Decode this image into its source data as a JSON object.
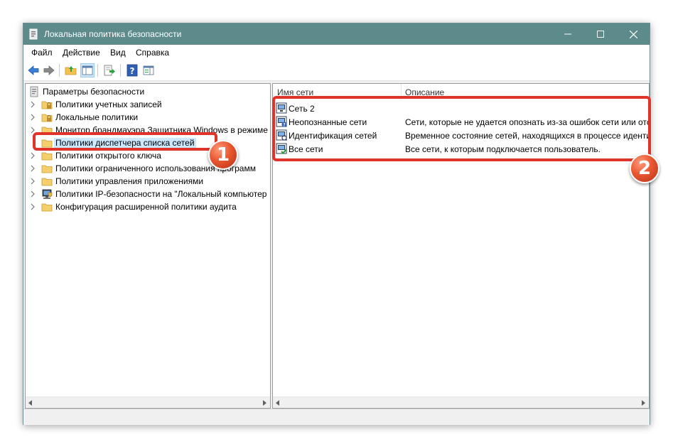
{
  "window": {
    "title": "Локальная политика безопасности",
    "controls": {
      "minimize": "—",
      "maximize": "☐",
      "close": "✕"
    }
  },
  "menu": [
    {
      "label": "Файл"
    },
    {
      "label": "Действие"
    },
    {
      "label": "Вид"
    },
    {
      "label": "Справка"
    }
  ],
  "toolbar": {
    "icons": [
      "back-arrow-icon",
      "forward-arrow-icon",
      "up-folder-icon",
      "show-hide-tree-icon",
      "export-list-icon",
      "help-icon",
      "show-hide-action-pane-icon"
    ]
  },
  "tree": {
    "root": "Параметры безопасности",
    "items": [
      {
        "label": "Политики учетных записей",
        "icon": "folder-lock-icon",
        "selected": false
      },
      {
        "label": "Локальные политики",
        "icon": "folder-lock-icon",
        "selected": false
      },
      {
        "label": "Монитор брандмауэра Защитника Windows в режиме",
        "icon": "folder-icon",
        "selected": false
      },
      {
        "label": "Политики диспетчера списка сетей",
        "icon": "folder-icon",
        "selected": true
      },
      {
        "label": "Политики открытого ключа",
        "icon": "folder-icon",
        "selected": false
      },
      {
        "label": "Политики ограниченного использования программ",
        "icon": "folder-icon",
        "selected": false
      },
      {
        "label": "Политики управления приложениями",
        "icon": "folder-icon",
        "selected": false
      },
      {
        "label": "Политики IP-безопасности на \"Локальный компьютер",
        "icon": "ipsec-policy-icon",
        "selected": false
      },
      {
        "label": "Конфигурация расширенной политики аудита",
        "icon": "folder-icon",
        "selected": false
      }
    ]
  },
  "list": {
    "columns": [
      "Имя сети",
      "Описание"
    ],
    "rows": [
      {
        "name": "Сеть 2",
        "description": "",
        "icon": "network-icon"
      },
      {
        "name": "Неопознанные сети",
        "description": "Сети, которые не удается опознать из-за ошибок сети или отс",
        "icon": "network-unknown-icon"
      },
      {
        "name": "Идентификация сетей",
        "description": "Временное состояние сетей, находящихся в процессе идентиф",
        "icon": "network-identifying-icon"
      },
      {
        "name": "Все сети",
        "description": "Все сети, к которым подключается пользователь.",
        "icon": "network-all-icon"
      }
    ]
  },
  "annotations": [
    {
      "number": "1"
    },
    {
      "number": "2"
    }
  ],
  "colors": {
    "titlebar": "#5d8a8b",
    "selection": "#cce8ff",
    "callout": "#e0332a"
  }
}
